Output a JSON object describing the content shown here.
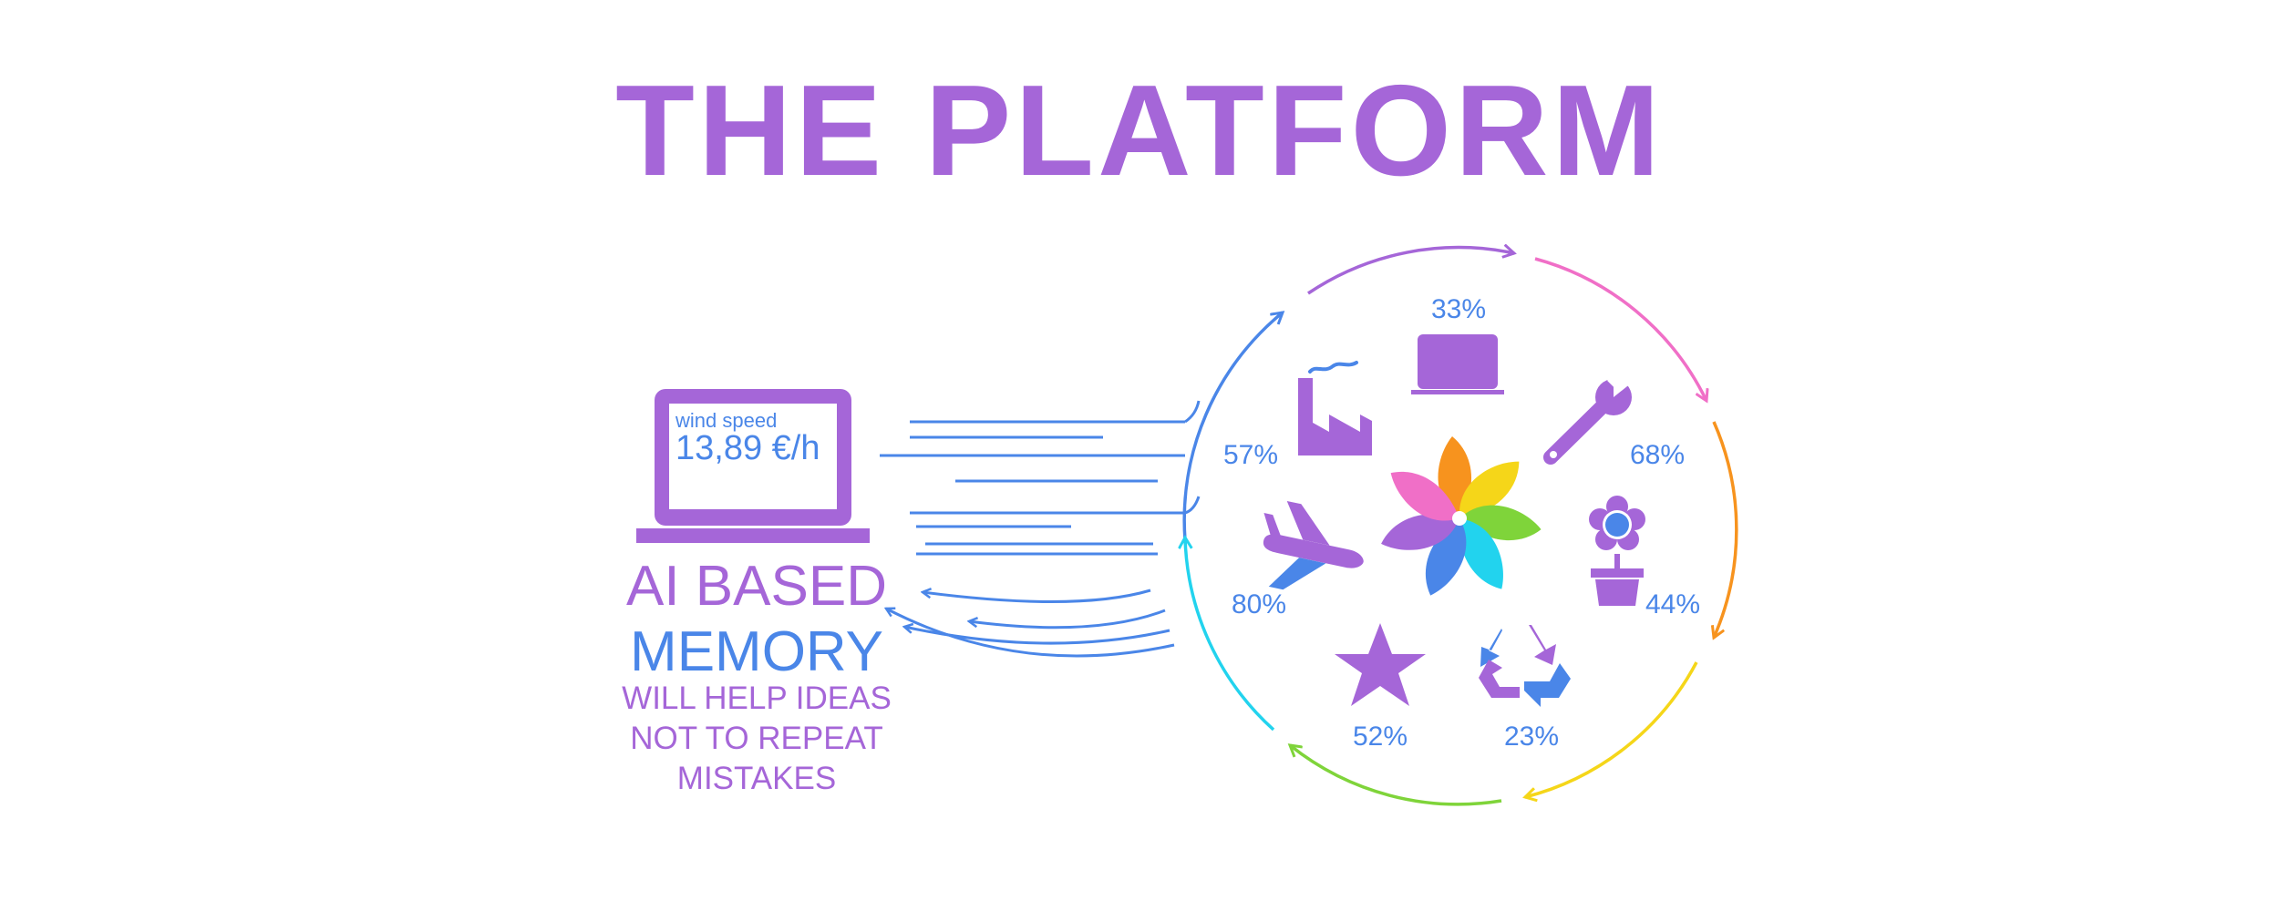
{
  "title": "THE PLATFORM",
  "laptop": {
    "screen_label": "wind speed",
    "screen_value": "13,89 €/h"
  },
  "memory": {
    "line1": "AI BASED",
    "line2": "MEMORY",
    "sub1": "WILL HELP IDEAS",
    "sub2": "NOT TO REPEAT",
    "sub3": "MISTAKES"
  },
  "cycle_items": [
    {
      "icon": "laptop-icon",
      "percent": "33%"
    },
    {
      "icon": "wrench-icon",
      "percent": "68%"
    },
    {
      "icon": "flower-pot-icon",
      "percent": "44%"
    },
    {
      "icon": "recycle-icon",
      "percent": "23%"
    },
    {
      "icon": "star-icon",
      "percent": "52%"
    },
    {
      "icon": "airplane-icon",
      "percent": "80%"
    },
    {
      "icon": "factory-icon",
      "percent": "57%"
    }
  ],
  "colors": {
    "purple": "#a566d8",
    "blue": "#4a86e8",
    "pink": "#f06fc7",
    "orange": "#f7931e",
    "yellow": "#f5d619",
    "green": "#7fd43a",
    "cyan": "#22d3ee"
  }
}
